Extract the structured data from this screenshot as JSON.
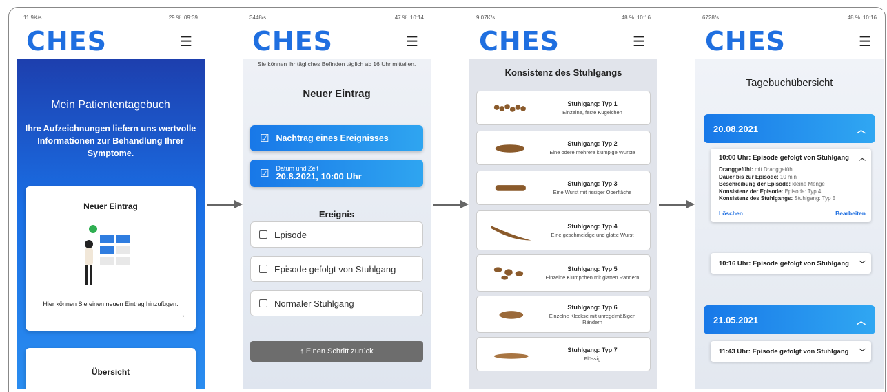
{
  "logo_text": "CHES",
  "menu_icon": "hamburger",
  "status_bars": [
    {
      "speed": "11,9K/s",
      "battery": "29 %",
      "time": "09:39"
    },
    {
      "speed": "3448/s",
      "battery": "47 %",
      "time": "10:14"
    },
    {
      "speed": "9,07K/s",
      "battery": "48 %",
      "time": "10:16"
    },
    {
      "speed": "6728/s",
      "battery": "48 %",
      "time": "10:16"
    }
  ],
  "screen1": {
    "title": "Mein Patiententagebuch",
    "subtitle": "Ihre Aufzeichnungen liefern uns wertvolle Informationen zur Behandlung Ihrer Symptome.",
    "card_new": {
      "title": "Neuer Eintrag",
      "hint": "Hier können Sie einen neuen Eintrag hinzufügen.",
      "arrow": "→"
    },
    "card_overview": {
      "title": "Übersicht"
    }
  },
  "screen2": {
    "info": "Sie können Ihr tägliches Befinden täglich ab 16 Uhr mitteilen.",
    "title": "Neuer Eintrag",
    "btn_nachtrag": "Nachtrag eines Ereignisses",
    "date_small": "Datum und Zeit",
    "date_big": "20.8.2021, 10:00 Uhr",
    "section": "Ereignis",
    "options": [
      "Episode",
      "Episode gefolgt von Stuhlgang",
      "Normaler Stuhlgang"
    ],
    "back": "↑  Einen Schritt zurück"
  },
  "screen3": {
    "title": "Konsistenz des Stuhlgangs",
    "types": [
      {
        "t": "Stuhlgang: Typ 1",
        "d": "Einzelne, feste Kügelchen"
      },
      {
        "t": "Stuhlgang: Typ 2",
        "d": "Eine odere mehrere klumpige Würste"
      },
      {
        "t": "Stuhlgang: Typ 3",
        "d": "Eine Wurst mit rissiger Oberfläche"
      },
      {
        "t": "Stuhlgang: Typ 4",
        "d": "Eine geschmeidige und glatte Wurst"
      },
      {
        "t": "Stuhlgang: Typ 5",
        "d": "Einzelne Klümpchen mit glatten Rändern"
      },
      {
        "t": "Stuhlgang: Typ 6",
        "d": "Einzelne Kleckse mit unregelmäßigen Rändern"
      },
      {
        "t": "Stuhlgang: Typ 7",
        "d": "Flüssig"
      }
    ]
  },
  "screen4": {
    "title": "Tagebuchübersicht",
    "date1": "20.08.2021",
    "entry1": {
      "head": "10:00 Uhr:  Episode gefolgt von Stuhlgang",
      "rows": [
        {
          "k": "Dranggefühl:",
          "v": "mit Dranggefühl"
        },
        {
          "k": "Dauer bis zur Episode:",
          "v": "10 min"
        },
        {
          "k": "Beschreibung der Episode:",
          "v": "kleine Menge"
        },
        {
          "k": "Konsistenz der Episode:",
          "v": "Episode: Typ 4"
        },
        {
          "k": "Konsistenz des Stuhlgangs:",
          "v": "Stuhlgang: Typ 5"
        }
      ],
      "delete": "Löschen",
      "edit": "Bearbeiten"
    },
    "entry2": "10:16 Uhr:  Episode gefolgt von Stuhlgang",
    "date2": "21.05.2021",
    "entry3": "11:43 Uhr:  Episode gefolgt von Stuhlgang"
  }
}
